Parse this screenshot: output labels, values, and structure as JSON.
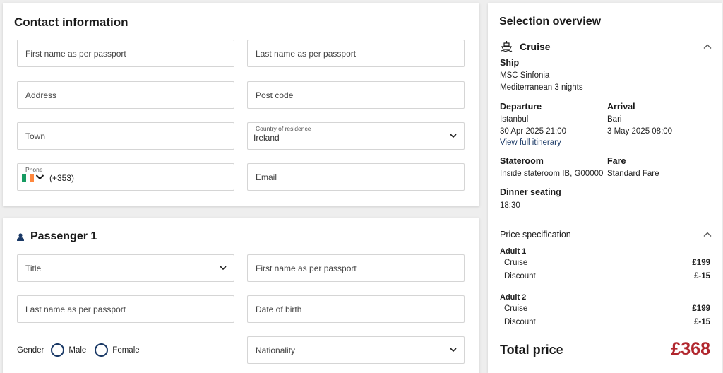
{
  "contact": {
    "title": "Contact information",
    "first_name_placeholder": "First name as per passport",
    "last_name_placeholder": "Last name as per passport",
    "address_placeholder": "Address",
    "postcode_placeholder": "Post code",
    "town_placeholder": "Town",
    "country_label": "Country of residence",
    "country_value": "Ireland",
    "phone_label": "Phone",
    "phone_code": "(+353)",
    "email_placeholder": "Email"
  },
  "passenger": {
    "title": "Passenger 1",
    "title_select_placeholder": "Title",
    "first_name_placeholder": "First name as per passport",
    "last_name_placeholder": "Last name as per passport",
    "dob_placeholder": "Date of birth",
    "gender_label": "Gender",
    "male_label": "Male",
    "female_label": "Female",
    "nationality_placeholder": "Nationality"
  },
  "overview": {
    "title": "Selection overview",
    "cruise_heading": "Cruise",
    "ship_heading": "Ship",
    "ship_name": "MSC Sinfonia",
    "ship_route": "Mediterranean 3 nights",
    "departure_heading": "Departure",
    "departure_port": "Istanbul",
    "departure_time": "30 Apr 2025 21:00",
    "arrival_heading": "Arrival",
    "arrival_port": "Bari",
    "arrival_time": "3 May 2025 08:00",
    "itinerary_link": "View full itinerary",
    "stateroom_heading": "Stateroom",
    "stateroom_value": "Inside stateroom IB, G00000",
    "fare_heading": "Fare",
    "fare_value": "Standard Fare",
    "dinner_heading": "Dinner seating",
    "dinner_value": "18:30",
    "price_spec_heading": "Price specification",
    "adults": [
      {
        "label": "Adult 1",
        "items": [
          {
            "name": "Cruise",
            "amount": "£199"
          },
          {
            "name": "Discount",
            "amount": "£-15"
          }
        ]
      },
      {
        "label": "Adult 2",
        "items": [
          {
            "name": "Cruise",
            "amount": "£199"
          },
          {
            "name": "Discount",
            "amount": "£-15"
          }
        ]
      }
    ],
    "total_label": "Total price",
    "total_value": "£368"
  },
  "colors": {
    "accent_navy": "#1a3966",
    "price_red": "#b1262d",
    "flag_green": "#169b62",
    "flag_white": "#ffffff",
    "flag_orange": "#ff883e"
  },
  "icons": {
    "cruise": "ship-icon",
    "passenger": "person-icon",
    "collapse": "chevron-up-icon",
    "dropdown": "chevron-down-icon"
  }
}
